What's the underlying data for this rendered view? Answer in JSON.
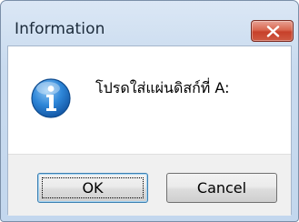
{
  "window": {
    "title": "Information"
  },
  "message": {
    "text": "โปรดใส่แผ่นดิสก์ที่ A:",
    "icon": "info-icon"
  },
  "buttons": {
    "ok_label": "OK",
    "cancel_label": "Cancel"
  },
  "colors": {
    "close_button": "#c7402a",
    "info_icon": "#1e6fc6",
    "focus_border": "#3c7fb1"
  }
}
